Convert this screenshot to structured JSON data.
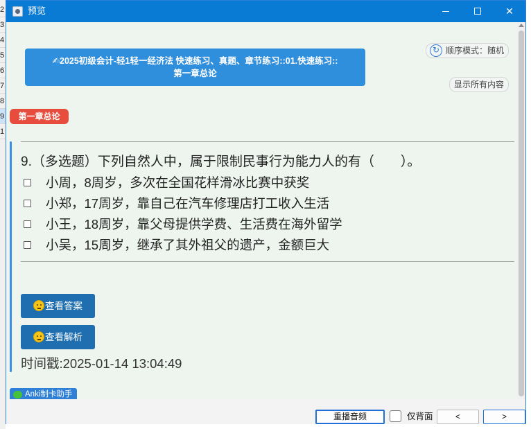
{
  "background_rows": [
    "2",
    "3",
    "4",
    "5",
    "6",
    "7",
    "8",
    "9",
    "1"
  ],
  "window": {
    "title": "预览",
    "controls": {
      "minimize": "minimize",
      "maximize": "maximize",
      "close": "✕"
    }
  },
  "deck_title_line1": "✍2025初级会计-轻1轻一经济法 快速练习、真题、章节练习::01.快速练习::",
  "deck_title_line2": "第一章总论",
  "mode_button": {
    "icon": "↻",
    "label": "顺序模式：随机"
  },
  "show_all_button": "显示所有内容",
  "chapter_tag": "第一章总论",
  "question": "9.（多选题）下列自然人中，属于限制民事行为能力人的有（　　）。",
  "options": [
    {
      "text": "小周，8周岁，多次在全国花样滑冰比赛中获奖",
      "checked": false
    },
    {
      "text": "小郑，17周岁，靠自己在汽车修理店打工收入生活",
      "checked": false
    },
    {
      "text": "小王，18周岁，靠父母提供学费、生活费在海外留学",
      "checked": false
    },
    {
      "text": "小吴，15周岁，继承了其外祖父的遗产，金额巨大",
      "checked": false
    }
  ],
  "view_answer_button": "查看答案",
  "view_analysis_button": "查看解析",
  "timestamp": "时间戳:2025-01-14 13:04:49",
  "anki_badge": "Anki制卡助手",
  "bottom": {
    "replay_button": "重播音频",
    "back_only_label": "仅背面",
    "prev_button": "<",
    "next_button": ">"
  },
  "colors": {
    "titlebar": "#0a7bd4",
    "deck_title_bg": "#2f8fdd",
    "chapter_tag_bg": "#e74c3c",
    "action_button_bg": "#1f6fb0",
    "content_bg": "#eef5ef"
  }
}
